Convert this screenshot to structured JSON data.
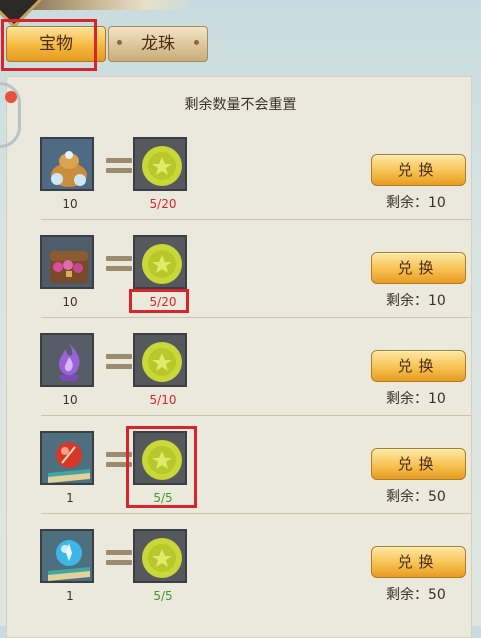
{
  "tabs": [
    {
      "label": "宝物",
      "active": true
    },
    {
      "label": "龙珠",
      "active": false
    }
  ],
  "panel_title": "剩余数量不会重置",
  "rows": [
    {
      "item_icon": "gold-ingot-bag-icon",
      "item_qty": "10",
      "cost_icon": "gold-coin-icon",
      "cost": "5/20",
      "cost_color": "#d8242b",
      "button": "兑换",
      "remaining": "剩余：10"
    },
    {
      "item_icon": "treasure-chest-icon",
      "item_qty": "10",
      "cost_icon": "gold-coin-icon",
      "cost": "5/20",
      "cost_color": "#d8242b",
      "button": "兑换",
      "remaining": "剩余：10"
    },
    {
      "item_icon": "purple-flame-crystal-icon",
      "item_qty": "10",
      "cost_icon": "gold-coin-icon",
      "cost": "5/10",
      "cost_color": "#d8242b",
      "button": "兑换",
      "remaining": "剩余：10"
    },
    {
      "item_icon": "red-orb-book-icon",
      "item_qty": "1",
      "cost_icon": "gold-coin-icon",
      "cost": "5/5",
      "cost_color": "#3f9a2c",
      "button": "兑换",
      "remaining": "剩余：50"
    },
    {
      "item_icon": "blue-orb-book-icon",
      "item_qty": "1",
      "cost_icon": "gold-coin-icon",
      "cost": "5/5",
      "cost_color": "#3f9a2c",
      "button": "兑换",
      "remaining": "剩余：50"
    }
  ],
  "colors": {
    "accent_gold": "#f4b842",
    "highlight_red": "#d8242b",
    "affordable_green": "#3f9a2c"
  }
}
